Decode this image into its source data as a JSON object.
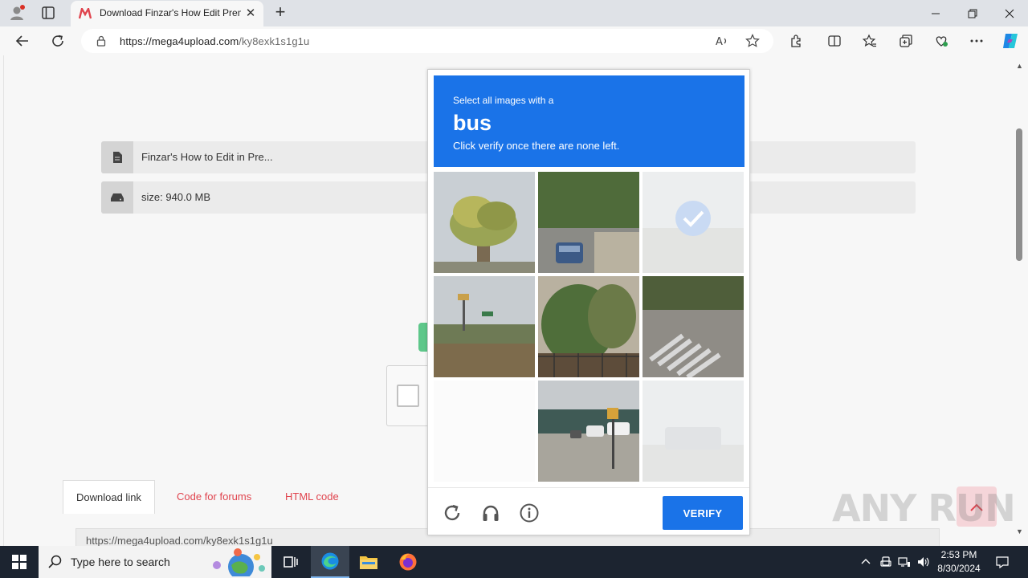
{
  "browser": {
    "tab_title": "Download Finzar's How Edit Prem",
    "url_host": "https://mega4upload.com",
    "url_path": "/ky8exk1s1g1u",
    "new_tab": "+"
  },
  "page": {
    "file_name": "Finzar's How to Edit in Pre...",
    "file_size": "size: 940.0 MB",
    "tabs": [
      "Download link",
      "Code for forums",
      "HTML code"
    ],
    "link_value": "https://mega4upload.com/ky8exk1s1g1u",
    "watermark": "ANY RUN"
  },
  "captcha": {
    "instruction": "Select all images with a",
    "object": "bus",
    "subtitle": "Click verify once there are none left.",
    "verify_label": "VERIFY",
    "tiles": [
      {
        "desc": "palm tree",
        "state": "normal"
      },
      {
        "desc": "street with blue car",
        "state": "normal"
      },
      {
        "desc": "selected faded tile",
        "state": "selected"
      },
      {
        "desc": "highway roadside",
        "state": "normal"
      },
      {
        "desc": "plants and fence",
        "state": "normal"
      },
      {
        "desc": "crosswalk",
        "state": "normal"
      },
      {
        "desc": "blank loading tile",
        "state": "blank"
      },
      {
        "desc": "parking lot store",
        "state": "normal"
      },
      {
        "desc": "faded bus tile",
        "state": "fading"
      }
    ]
  },
  "taskbar": {
    "search_placeholder": "Type here to search",
    "time": "2:53 PM",
    "date": "8/30/2024"
  },
  "colors": {
    "captcha_blue": "#1a73e8",
    "link_red": "#e0444e",
    "taskbar": "#1c2430"
  }
}
